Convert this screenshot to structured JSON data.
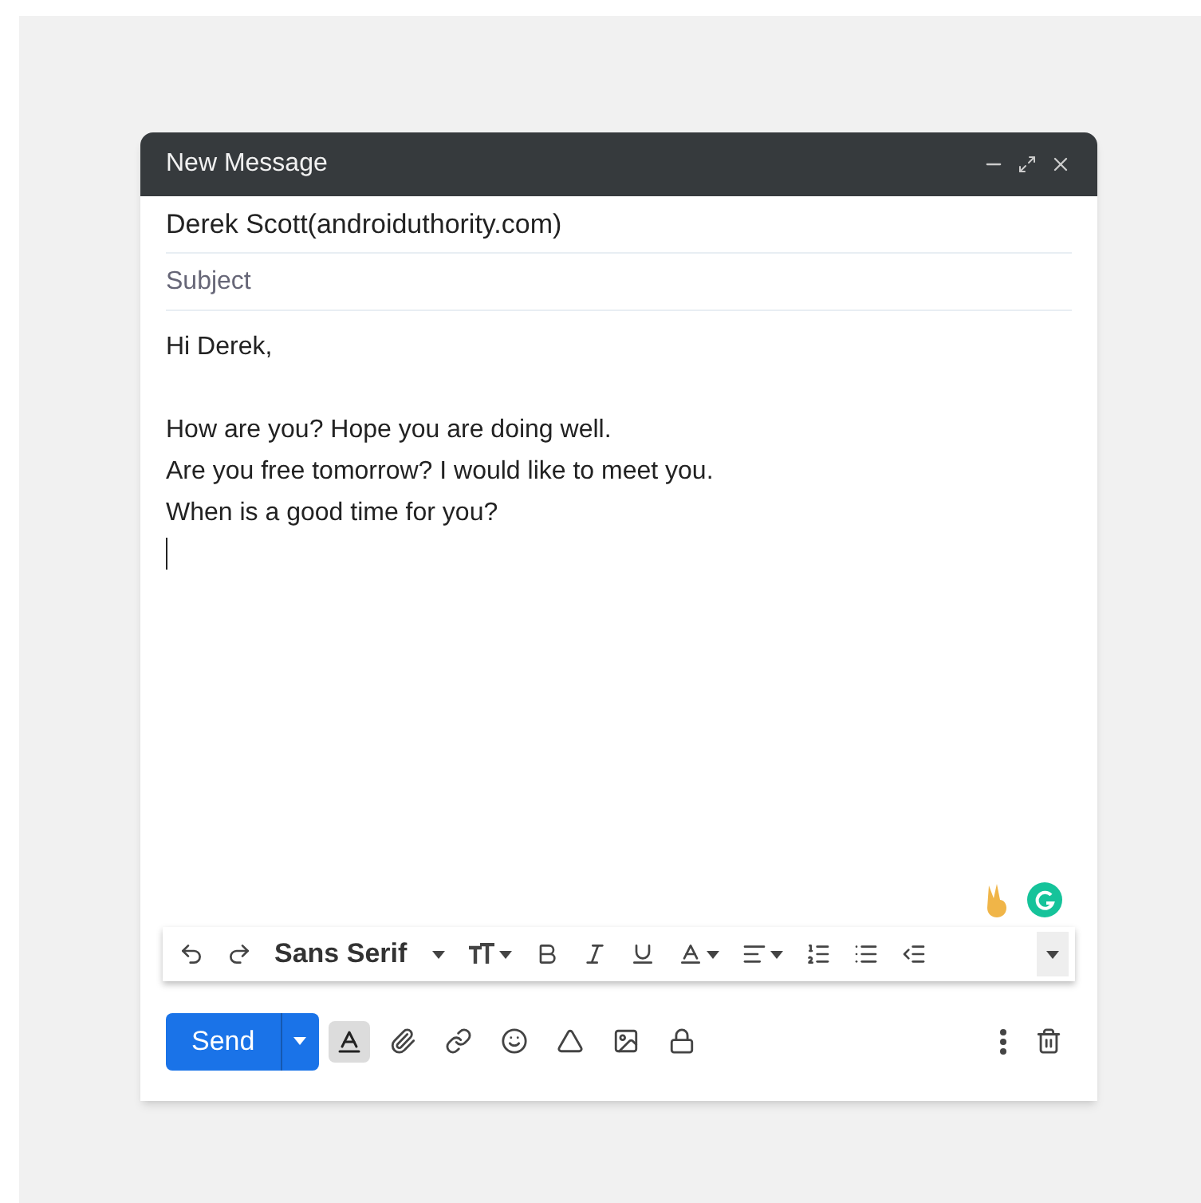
{
  "window": {
    "title": "New Message"
  },
  "recipient": "Derek Scott(androiduthority.com)",
  "subject": {
    "placeholder": "Subject"
  },
  "body": [
    [
      "Hi Derek,"
    ],
    [
      "How are you? Hope you are doing well.",
      "Are you free tomorrow? I would like to meet you.",
      "When is a good time for you?"
    ]
  ],
  "toolbar": {
    "font": "Sans Serif"
  },
  "formatting_toggle": {
    "selected": true
  },
  "send": {
    "label": "Send"
  }
}
